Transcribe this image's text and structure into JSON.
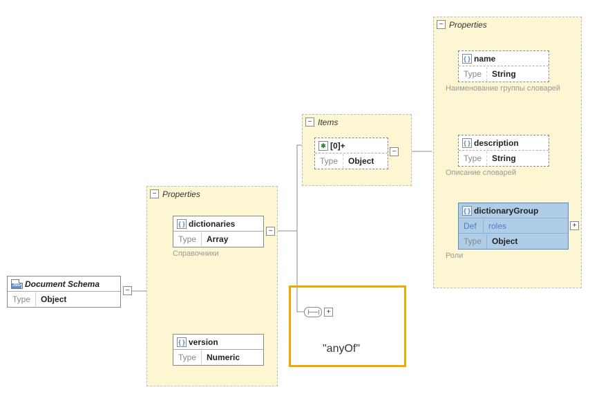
{
  "root": {
    "title": "Document Schema",
    "type_label": "Type",
    "type_value": "Object"
  },
  "props1": {
    "title": "Properties",
    "dictionaries": {
      "name": "dictionaries",
      "type_label": "Type",
      "type_value": "Array",
      "annotation": "Справочники"
    },
    "version": {
      "name": "version",
      "type_label": "Type",
      "type_value": "Numeric"
    }
  },
  "items": {
    "title": "Items",
    "entry": {
      "index": "[0]+",
      "type_label": "Type",
      "type_value": "Object"
    }
  },
  "props2": {
    "title": "Properties",
    "name": {
      "name": "name",
      "type_label": "Type",
      "type_value": "String",
      "annotation": "Наименование группы словарей"
    },
    "description": {
      "name": "description",
      "type_label": "Type",
      "type_value": "String",
      "annotation": "Описание словарей"
    },
    "dictionaryGroup": {
      "name": "dictionaryGroup",
      "def_label": "Def",
      "def_value": "roles",
      "type_label": "Type",
      "type_value": "Object",
      "annotation": "Роли"
    }
  },
  "anyof": {
    "label": "\"anyOf\""
  },
  "icons": {
    "minus": "−",
    "plus": "+",
    "braces": "{ }",
    "star": "✱"
  }
}
